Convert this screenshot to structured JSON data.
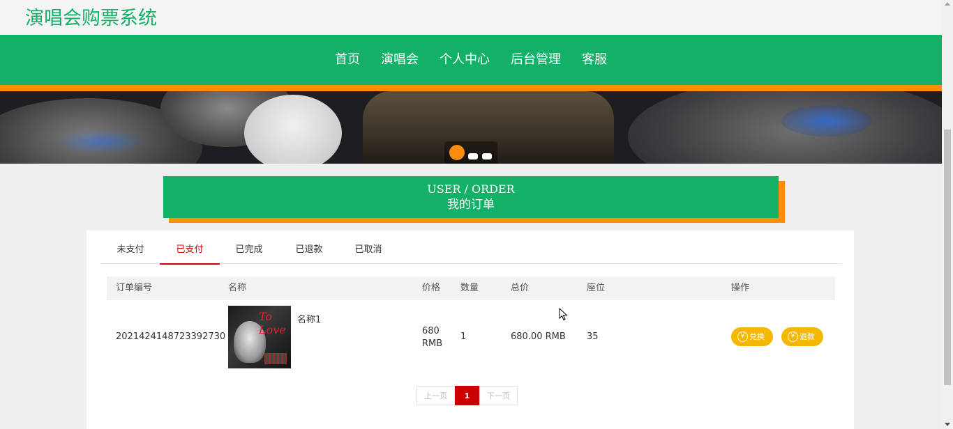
{
  "site": {
    "title": "演唱会购票系统"
  },
  "nav": {
    "items": [
      "首页",
      "演唱会",
      "个人中心",
      "后台管理",
      "客服"
    ]
  },
  "section": {
    "title_en": "USER / ORDER",
    "title_cn": "我的订单"
  },
  "tabs": [
    "未支付",
    "已支付",
    "已完成",
    "已退款",
    "已取消"
  ],
  "active_tab": "已支付",
  "table": {
    "headers": [
      "订单编号",
      "名称",
      "价格",
      "数量",
      "总价",
      "座位",
      "操作"
    ],
    "rows": [
      {
        "order_no": "20214241487233 92730",
        "name": "名称1",
        "price_line1": "680",
        "price_line2": "RMB",
        "qty": "1",
        "total": "680.00 RMB",
        "seat": "35",
        "actions": [
          "兑换",
          "退款"
        ]
      }
    ]
  },
  "pager": {
    "prev": "上一页",
    "current": "1",
    "next": "下一页"
  },
  "colors": {
    "brand_green": "#13b067",
    "accent_orange": "#ff8c0a",
    "active_red": "#cc0000",
    "button_yellow": "#f5b800"
  },
  "icons": {
    "yen": "¥"
  }
}
